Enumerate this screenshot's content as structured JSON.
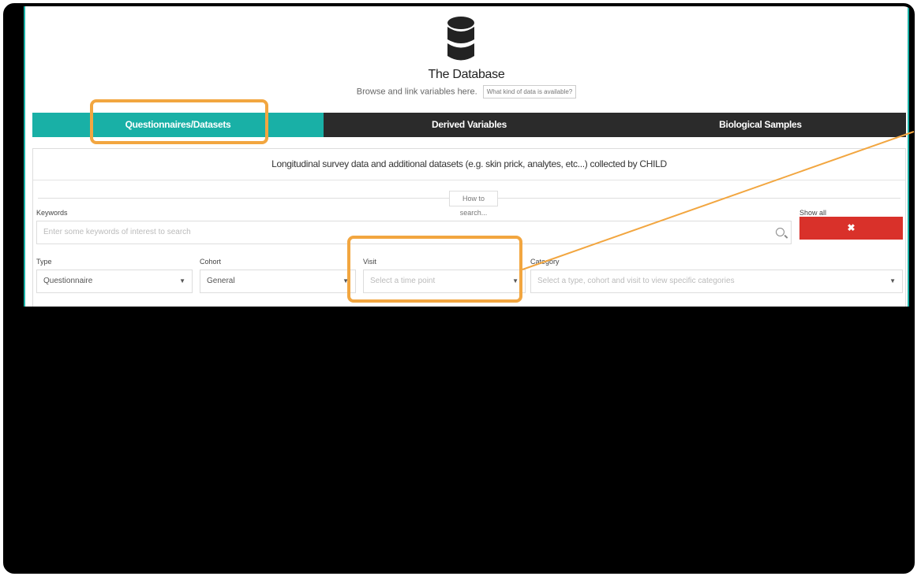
{
  "header": {
    "logo_icon": "database-icon",
    "title": "The Database",
    "subtitle": "Browse and link variables here.",
    "info_button": "What kind of data is available?"
  },
  "tabs": [
    {
      "label": "Questionnaires/Datasets",
      "active": true
    },
    {
      "label": "Derived Variables",
      "active": false
    },
    {
      "label": "Biological Samples",
      "active": false
    }
  ],
  "panel": {
    "description": "Longitudinal survey data and additional datasets (e.g. skin prick, analytes, etc...) collected by CHILD",
    "howto_button": "How to search...",
    "keywords": {
      "label": "Keywords",
      "placeholder": "Enter some keywords of interest to search"
    },
    "show_all": {
      "label": "Show all",
      "button": "✖"
    },
    "type": {
      "label": "Type",
      "value": "Questionnaire"
    },
    "cohort": {
      "label": "Cohort",
      "value": "General"
    },
    "visit": {
      "label": "Visit",
      "placeholder": "Select a time point"
    },
    "category": {
      "label": "Category",
      "placeholder": "Select a type, cohort and visit to view specific categories"
    }
  },
  "colors": {
    "accent": "#19b0a6",
    "dark_tab": "#2b2b2b",
    "clear": "#d9312a",
    "annotation": "#f2a640"
  }
}
